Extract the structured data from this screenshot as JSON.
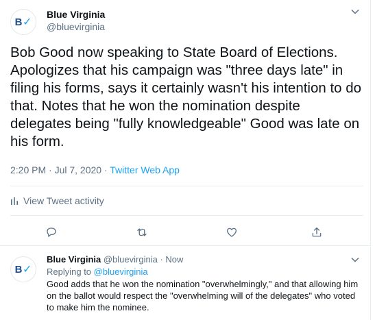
{
  "main_tweet": {
    "author_name": "Blue Virginia",
    "author_handle": "@bluevirginia",
    "avatar_text": "BV",
    "text": "Bob Good now speaking to State Board of Elections. Apologizes that his campaign was \"three days late\" in filing his forms, says it certainly wasn't his intention to do that. Notes that he won the nomination despite delegates being \"fully knowledgeable\" Good was late on his form.",
    "time": "2:20 PM · Jul 7, 2020 · ",
    "app": "Twitter Web App",
    "view_activity": "View Tweet activity"
  },
  "reply_tweet": {
    "author_name": "Blue Virginia",
    "author_handle": "@bluevirginia",
    "separator": " · ",
    "time": "Now",
    "replying_prefix": "Replying to ",
    "replying_to": "@bluevirginia",
    "text": "Good adds that he won the nomination \"overwhelmingly,\" and that allowing him on the ballot would respect the \"overwhelming will of the delegates\" who voted to make him the nominee."
  },
  "icons": [
    "chevron-down-icon",
    "bar-chart-icon",
    "reply-icon",
    "retweet-icon",
    "like-icon",
    "share-icon"
  ],
  "colors": {
    "link": "#1da1f2",
    "secondary_text": "#5b7083",
    "border": "#e6ecf0",
    "brand": "#1f4e8c"
  }
}
